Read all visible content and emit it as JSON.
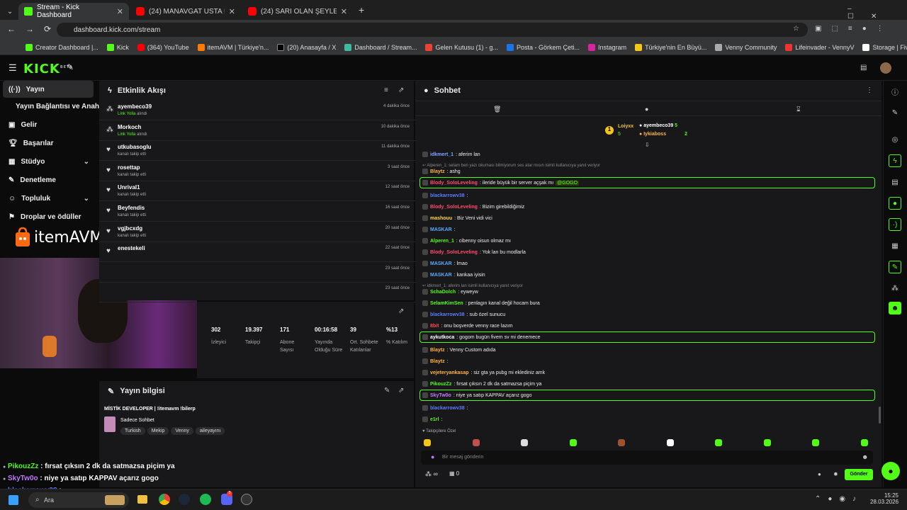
{
  "browser": {
    "tabs": [
      {
        "title": "Stream - Kick Dashboard",
        "favicon": "kick-icon"
      },
      {
        "title": "(24) MANAVGAT USTA HACKER",
        "favicon": "youtube-icon"
      },
      {
        "title": "(24) SARI OLAN ŞEYLER LEZZE",
        "favicon": "youtube-icon"
      }
    ],
    "url": "dashboard.kick.com/stream",
    "bookmarks": [
      "Creator Dashboard |...",
      "Kick",
      "(364) YouTube",
      "itemAVM | Türkiye'n...",
      "(20) Anasayfa / X",
      "Dashboard / Stream...",
      "Gelen Kutusu (1) - g...",
      "Posta - Görkem Çeti...",
      "Instagram",
      "Türkiye'nin En Büyü...",
      "Venny Community",
      "Lifeinvader - VennyV",
      "Storage | Fivemanage"
    ]
  },
  "kick": {
    "logo": "KICK",
    "beta": "BETA"
  },
  "sidebar": {
    "items": [
      {
        "label": "Yayın",
        "icon": "broadcast-icon"
      },
      {
        "label": "Yayın Bağlantısı ve Anahtarı",
        "icon": ""
      },
      {
        "label": "Gelir",
        "icon": "wallet-icon"
      },
      {
        "label": "Başarılar",
        "icon": "trophy-icon"
      },
      {
        "label": "Stüdyo",
        "icon": "studio-icon"
      },
      {
        "label": "Denetleme",
        "icon": "gavel-icon"
      },
      {
        "label": "Topluluk",
        "icon": "people-icon"
      },
      {
        "label": "Droplar ve ödüller",
        "icon": "gift-icon"
      }
    ]
  },
  "overlay_logo": "itemAVM",
  "activity": {
    "title": "Etkinlik Akışı",
    "rows": [
      {
        "name": "ayembeco39",
        "sub_green": "Link Yolla",
        "sub": " alındı",
        "time": "4 dakika önce",
        "icon": "reward-icon"
      },
      {
        "name": "Morkoch",
        "sub_green": "Link Yolla",
        "sub": " alındı",
        "time": "10 dakika önce",
        "icon": "reward-icon"
      },
      {
        "name": "utkubasoglu",
        "sub_green": "",
        "sub": "kanalı takip etti",
        "time": "11 dakika önce",
        "icon": "heart-icon"
      },
      {
        "name": "rosettap",
        "sub_green": "",
        "sub": "kanalı takip etti",
        "time": "3 saat önce",
        "icon": "heart-icon"
      },
      {
        "name": "Unrival1",
        "sub_green": "",
        "sub": "kanalı takip etti",
        "time": "12 saat önce",
        "icon": "heart-icon"
      },
      {
        "name": "Beyfendis",
        "sub_green": "",
        "sub": "kanalı takip etti",
        "time": "16 saat önce",
        "icon": "heart-icon"
      },
      {
        "name": "vgjbcxdg",
        "sub_green": "",
        "sub": "kanalı takip etti",
        "time": "20 saat önce",
        "icon": "heart-icon"
      },
      {
        "name": "enestekeli",
        "sub_green": "",
        "sub": "",
        "time": "22 saat önce",
        "icon": "heart-icon"
      },
      {
        "name": "",
        "sub_green": "",
        "sub": "",
        "time": "23 saat önce",
        "icon": ""
      },
      {
        "name": "",
        "sub_green": "",
        "sub": "",
        "time": "23 saat önce",
        "icon": ""
      }
    ]
  },
  "stats": [
    {
      "value": "302",
      "label": "İzleyici"
    },
    {
      "value": "19.397",
      "label": "Takipçi"
    },
    {
      "value": "171",
      "label": "Abone Sayısı"
    },
    {
      "value": "00:16:58",
      "label": "Yayında Olduğu Süre"
    },
    {
      "value": "39",
      "label": "Ort. Sohbete Katılanlar"
    },
    {
      "value": "%13",
      "label": "% Katılım"
    }
  ],
  "stream_info": {
    "title": "Yayın bilgisi",
    "stream_title": "MİSTİK DEVELOPER | !itemavm !bilerp",
    "category": "Sadece Sohbet",
    "tags": [
      "Turkish",
      "Mekip",
      "Venny",
      "aileyayını"
    ]
  },
  "chat": {
    "title": "Sohbet",
    "leaders": [
      {
        "name": "Loiyxx",
        "count": "5"
      },
      {
        "name": "ayembeco39",
        "count": "5"
      },
      {
        "name": "Iykiaboss",
        "count": "2"
      }
    ],
    "messages": [
      {
        "user": "idkmert_1",
        "color": "#7ba7ff",
        "text": ": aferim lan"
      },
      {
        "reply": "Alperen_1: selam ben yazı okuması bilmiyorum ses atar mısın isimli kullanıcıya yanıt veriyor"
      },
      {
        "user": "Blaytz",
        "color": "#ffb347",
        "text": ": ashg"
      },
      {
        "user": "Blody_SoloLeveling",
        "color": "#ff4d6d",
        "text": ": ileride büyük bir server açşak mı ",
        "mention": "@GOGO",
        "highlight": true
      },
      {
        "user": "blackarrowv38",
        "color": "#5b7cff",
        "text": ":"
      },
      {
        "user": "Blody_SoloLeveling",
        "color": "#ff4d6d",
        "text": ": Bizim girebildiğimiz"
      },
      {
        "user": "mashouu",
        "color": "#ffd84d",
        "text": ": Biz Veni vidi vici"
      },
      {
        "user": "MASKAR",
        "color": "#5ba8ff",
        "text": ":"
      },
      {
        "user": "Alperen_1",
        "color": "#53fc18",
        "text": ": cibenny oisun olmaz mı"
      },
      {
        "user": "Blody_SoloLeveling",
        "color": "#ff4d6d",
        "text": ": Yok lan bu modlarla"
      },
      {
        "user": "MASKAR",
        "color": "#5ba8ff",
        "text": ": lmao"
      },
      {
        "user": "MASKAR",
        "color": "#5ba8ff",
        "text": ": kankaa iyisin"
      },
      {
        "reply": "idkmert_1: aferim lan isimli kullanıcıya yanıt veriyor"
      },
      {
        "user": "SchaDolch",
        "color": "#53fc18",
        "text": ": eyweyw"
      },
      {
        "user": "SelamKimSen",
        "color": "#53fc18",
        "text": ": penlagın kanal değil hocam bura"
      },
      {
        "user": "blackarrowv38",
        "color": "#5b7cff",
        "text": ": sub özel sunucu"
      },
      {
        "user": "8bit",
        "color": "#ff4d4d",
        "text": ": onu boşverde venny race lazım"
      },
      {
        "user": "aykutkoca",
        "color": "#ffffff",
        "text": ": gogom bugün fivem sv mi denemece",
        "highlight": true
      },
      {
        "user": "Blaytz",
        "color": "#ffb347",
        "text": ": Venny Custom adıda"
      },
      {
        "user": "Blaytz",
        "color": "#ffb347",
        "text": ":"
      },
      {
        "user": "vejeteryankasap",
        "color": "#ffb347",
        "text": ": siz gta ya pubg mi eklediniz amk"
      },
      {
        "user": "PikouzZz",
        "color": "#53fc18",
        "text": ": fırsat çıksın 2 dk da satmazsa piçim ya"
      },
      {
        "user": "SkyTw0o",
        "color": "#c27bff",
        "text": ": niye ya satıp KAPPAV açarız gogo",
        "highlight": true
      },
      {
        "user": "blackarrowv38",
        "color": "#5b7cff",
        "text": ":"
      },
      {
        "user": "e1rl",
        "color": "#53fc18",
        "text": ":"
      }
    ],
    "emote_section": "Takipçilere Özel",
    "input_placeholder": "Bir mesaj gönderin",
    "viewer_infinity": "∞",
    "gift_count": "0",
    "send_label": "Gönder"
  },
  "overlay_chat": [
    {
      "user": "PikouzZz",
      "color": "#53fc18",
      "text": " : fırsat çıksın 2 dk da satmazsa piçim ya"
    },
    {
      "user": "SkyTw0o",
      "color": "#c27bff",
      "text": " : niye ya satıp KAPPAV açarız gogo"
    },
    {
      "user": "blackarrowv38",
      "color": "#5b7cff",
      "text": " :"
    },
    {
      "user": "e1rl",
      "color": "#53fc18",
      "text": ""
    }
  ],
  "taskbar": {
    "search": "Ara",
    "time": "15:25",
    "date": "28.03.2026",
    "badge_count": "3"
  }
}
